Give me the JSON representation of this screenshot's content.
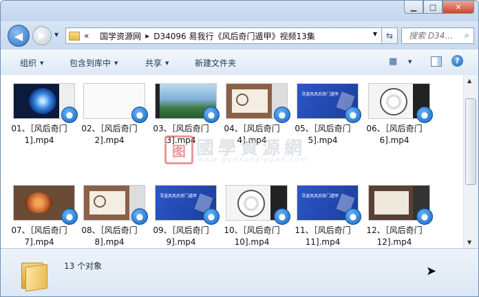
{
  "window": {
    "minimize": "▁",
    "maximize": "□",
    "close": "✕"
  },
  "nav": {
    "back_icon": "◀",
    "forward_icon": "▶",
    "dropdown_icon": "▼",
    "address": {
      "overflow": "«",
      "crumbs": [
        "国学资源网",
        "D34096 易我行《风后奇门遁甲》视频13集"
      ],
      "separator": "▸"
    },
    "search_placeholder": "搜索 D34..."
  },
  "toolbar": {
    "organize": "组织",
    "include": "包含到库中",
    "share": "共享",
    "new_folder": "新建文件夹"
  },
  "files": [
    {
      "line1": "01、［风后奇门",
      "line2": "1].mp4",
      "thumb": "blue-ring"
    },
    {
      "line1": "02、［风后奇门",
      "line2": "2].mp4",
      "thumb": "blank"
    },
    {
      "line1": "03、［风后奇门",
      "line2": "3].mp4",
      "thumb": "landscape"
    },
    {
      "line1": "04、［风后奇门",
      "line2": "4].mp4",
      "thumb": "slide-brown"
    },
    {
      "line1": "05、［风后奇门",
      "line2": "5].mp4",
      "thumb": "blue-title"
    },
    {
      "line1": "06、［风后奇门",
      "line2": "6].mp4",
      "thumb": "diagram"
    },
    {
      "line1": "07、［风后奇门",
      "line2": "7].mp4",
      "thumb": "orange-disk"
    },
    {
      "line1": "08、［风后奇门",
      "line2": "8].mp4",
      "thumb": "slide-brown"
    },
    {
      "line1": "09、［风后奇门",
      "line2": "9].mp4",
      "thumb": "blue-title"
    },
    {
      "line1": "10、［风后奇门",
      "line2": "10].mp4",
      "thumb": "diagram"
    },
    {
      "line1": "11、［风后奇门",
      "line2": "11].mp4",
      "thumb": "blue-title"
    },
    {
      "line1": "12、［风后奇门",
      "line2": "12].mp4",
      "thumb": "slide-dark"
    }
  ],
  "thumb_title": "寻道风风后奇门遁甲",
  "status": {
    "count": "13 个对象"
  },
  "watermark": {
    "cn": "國學資源網",
    "url": "www.guoxueziyuan.com"
  },
  "colors": {
    "accent": "#2f6fba",
    "chrome": "#dbe7f4",
    "slide_blue": "#2b57c9",
    "slide_brown": "#8a6148"
  }
}
